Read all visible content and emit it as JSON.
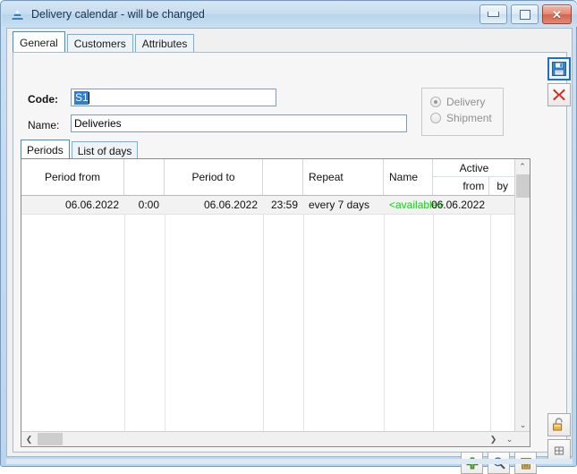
{
  "window": {
    "title": "Delivery calendar - will be changed",
    "icon": "app-triangle-icon",
    "minimize_label": "",
    "maximize_label": "",
    "close_label": "✕"
  },
  "outer_tabs": [
    {
      "label": "General",
      "active": true
    },
    {
      "label": "Customers",
      "active": false
    },
    {
      "label": "Attributes",
      "active": false
    }
  ],
  "form": {
    "code_label": "Code:",
    "code_value": "S1",
    "name_label": "Name:",
    "name_value": "Deliveries"
  },
  "type_group": {
    "options": [
      {
        "label": "Delivery",
        "selected": true
      },
      {
        "label": "Shipment",
        "selected": false
      }
    ],
    "disabled": true
  },
  "inner_tabs": [
    {
      "label": "Periods",
      "active": true
    },
    {
      "label": "List of days",
      "active": false
    }
  ],
  "grid": {
    "columns": [
      {
        "key": "period_from_date",
        "label": "Period from"
      },
      {
        "key": "period_from_time",
        "label": ""
      },
      {
        "key": "period_to_date",
        "label": "Period to"
      },
      {
        "key": "period_to_time",
        "label": ""
      },
      {
        "key": "repeat",
        "label": "Repeat"
      },
      {
        "key": "name",
        "label": "Name"
      },
      {
        "key": "active_from",
        "label": "from"
      },
      {
        "key": "active_by",
        "label": "by"
      }
    ],
    "group_header": "Active",
    "rows": [
      {
        "period_from_date": "06.06.2022",
        "period_from_time": "0:00",
        "period_to_date": "06.06.2022",
        "period_to_time": "23:59",
        "repeat": "every 7 days",
        "name": "<available>",
        "name_color": "#00dd00",
        "active_from": "06.06.2022",
        "active_by": ""
      }
    ]
  },
  "grid_toolbar": [
    {
      "name": "add",
      "glyph": "+",
      "color": "#4a9a28"
    },
    {
      "name": "search",
      "glyph": "search",
      "color": "#3f7fbf"
    },
    {
      "name": "delete",
      "glyph": "trash",
      "color": "#b0892f"
    }
  ],
  "side_toolbar": [
    {
      "name": "save",
      "glyph": "floppy-disk",
      "color": "#2f6fb5"
    },
    {
      "name": "cancel",
      "glyph": "red-x",
      "color": "#cc2222"
    },
    {
      "name": "unlock",
      "glyph": "open-padlock",
      "color": "#e0a12e"
    },
    {
      "name": "misc",
      "glyph": "small-panel",
      "color": "#777777"
    }
  ],
  "scrollbars": {
    "vertical_up": "⌃",
    "vertical_down": "⌄",
    "horizontal_left": "❮",
    "horizontal_right": "❯",
    "corner_down": "⌄"
  }
}
